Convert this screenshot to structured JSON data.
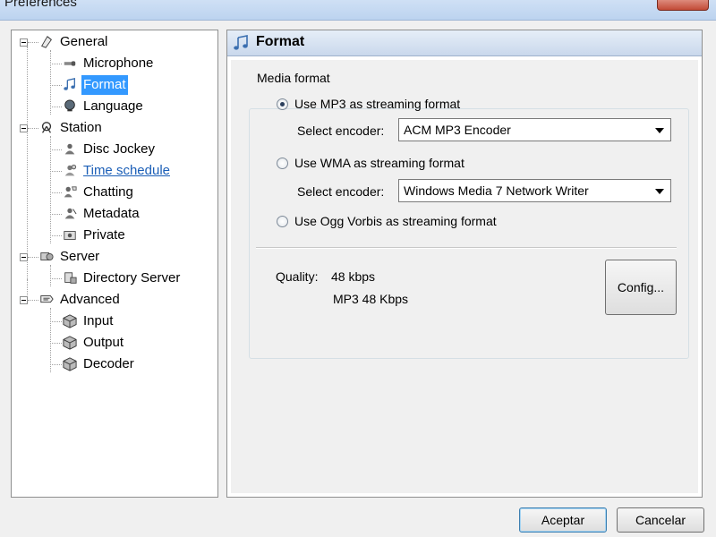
{
  "window": {
    "title": "Preferences"
  },
  "tree": {
    "items": [
      {
        "label": "General",
        "icon": "general-icon",
        "level": 0
      },
      {
        "label": "Microphone",
        "icon": "microphone-icon",
        "level": 1
      },
      {
        "label": "Format",
        "icon": "music-note-icon",
        "level": 1,
        "selected": true
      },
      {
        "label": "Language",
        "icon": "globe-icon",
        "level": 1
      },
      {
        "label": "Station",
        "icon": "station-icon",
        "level": 0
      },
      {
        "label": "Disc Jockey",
        "icon": "disc-jockey-icon",
        "level": 1
      },
      {
        "label": "Time schedule",
        "icon": "time-schedule-icon",
        "level": 1,
        "hover": true
      },
      {
        "label": "Chatting",
        "icon": "chatting-icon",
        "level": 1
      },
      {
        "label": "Metadata",
        "icon": "metadata-icon",
        "level": 1
      },
      {
        "label": "Private",
        "icon": "private-icon",
        "level": 1
      },
      {
        "label": "Server",
        "icon": "server-icon",
        "level": 0
      },
      {
        "label": "Directory Server",
        "icon": "directory-server-icon",
        "level": 1
      },
      {
        "label": "Advanced",
        "icon": "advanced-icon",
        "level": 0
      },
      {
        "label": "Input",
        "icon": "cube-icon",
        "level": 1
      },
      {
        "label": "Output",
        "icon": "cube-icon",
        "level": 1
      },
      {
        "label": "Decoder",
        "icon": "cube-icon",
        "level": 1
      }
    ]
  },
  "panel": {
    "title": "Format",
    "group_title": "Media format",
    "mp3": {
      "label": "Use MP3 as streaming format",
      "checked": true,
      "encoder_label": "Select encoder:",
      "encoder_value": "ACM MP3 Encoder"
    },
    "wma": {
      "label": "Use WMA as streaming format",
      "checked": false,
      "encoder_label": "Select encoder:",
      "encoder_value": "Windows Media 7 Network Writer"
    },
    "ogg": {
      "label": "Use Ogg Vorbis as streaming format",
      "checked": false
    },
    "quality_label": "Quality:",
    "quality_value": "48 kbps",
    "quality_detail": "MP3 48 Kbps",
    "config_button": "Config..."
  },
  "footer": {
    "ok_button": "Aceptar",
    "cancel_button": "Cancelar"
  },
  "colors": {
    "selection": "#3399ff",
    "link": "#1c5fb7"
  }
}
